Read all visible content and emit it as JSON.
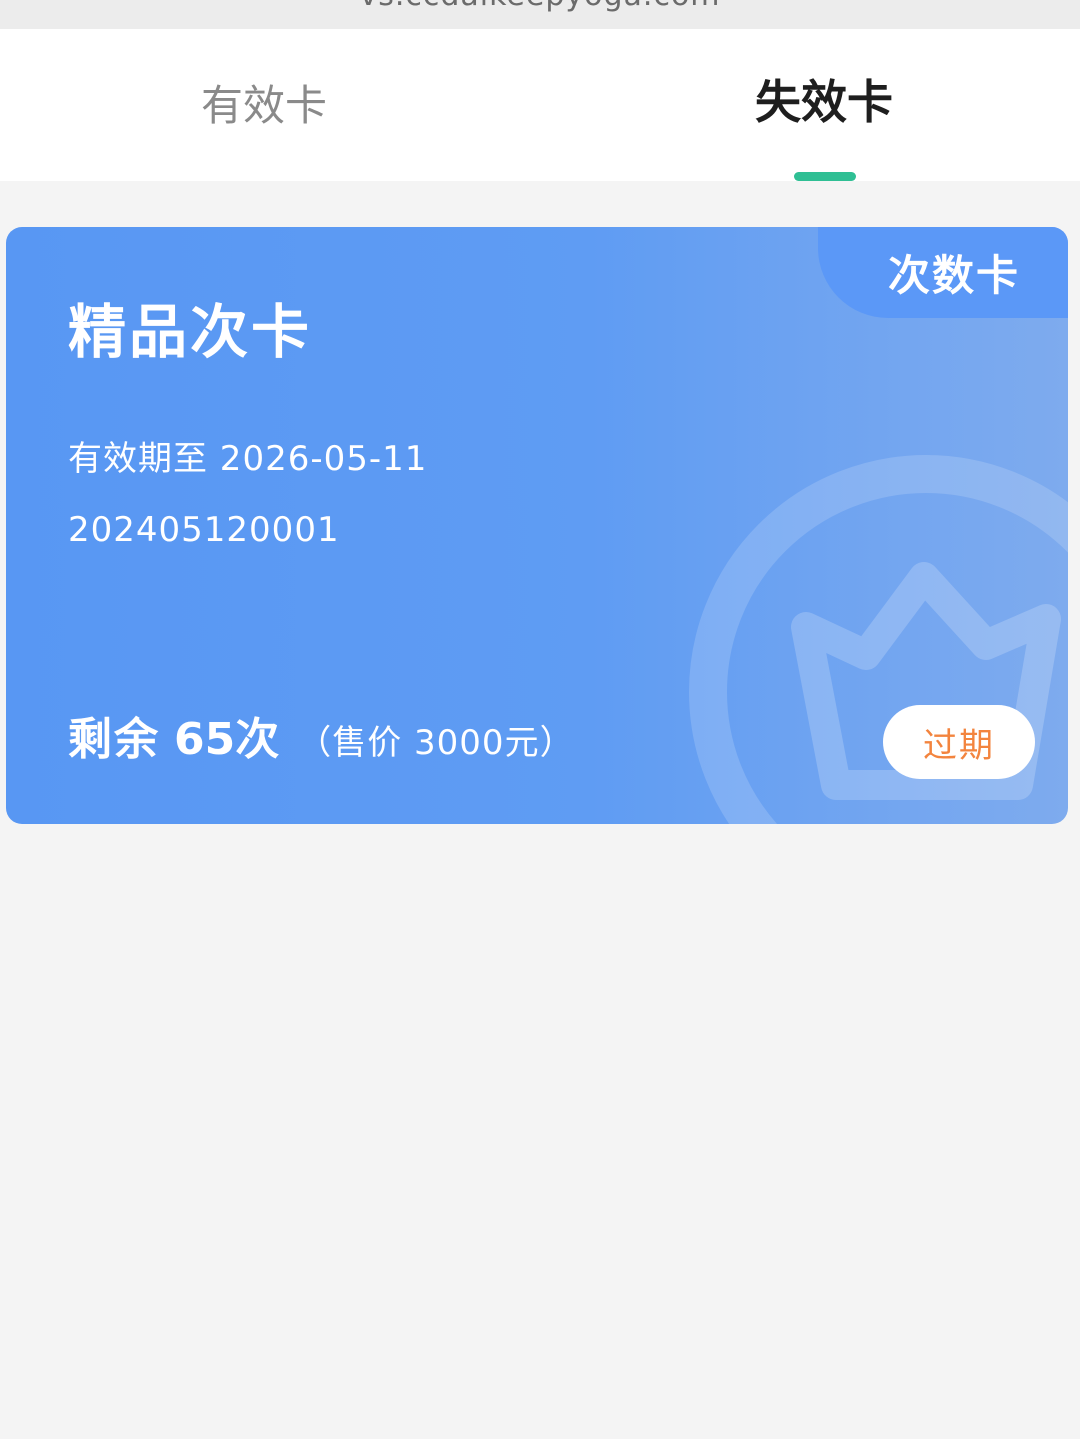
{
  "browser": {
    "url": "vs.ccdaikeepyoga.com"
  },
  "tabs": [
    {
      "label": "有效卡",
      "active": false
    },
    {
      "label": "失效卡",
      "active": true
    }
  ],
  "colors": {
    "tab_indicator": "#2fbf94",
    "card_background": "#5f9cf3",
    "status_text": "#f3843e"
  },
  "card": {
    "type_tag": "次数卡",
    "title": "精品次卡",
    "expiry": "有效期至 2026-05-11",
    "number": "202405120001",
    "remaining_label": "剩余",
    "remaining_count": "65",
    "remaining_unit": "次",
    "price_note": "（售价 3000元）",
    "status": "过期",
    "decoration_icon": "crown-icon"
  }
}
